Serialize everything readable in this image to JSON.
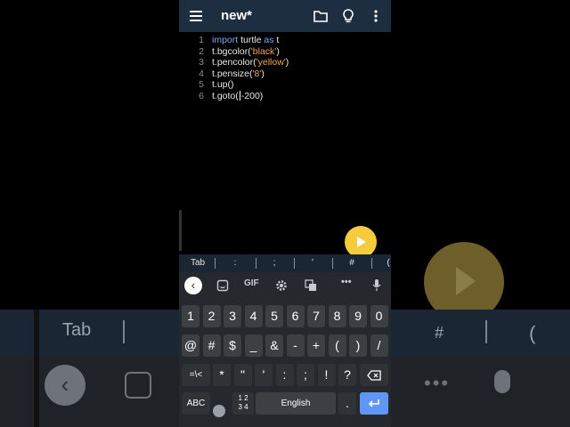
{
  "app": {
    "title": "new*",
    "icons": [
      "menu-icon",
      "folder-icon",
      "lightbulb-icon",
      "more-vert-icon"
    ]
  },
  "editor": {
    "lines": [
      {
        "num": "1",
        "parts": [
          {
            "t": "import",
            "k": "kw"
          },
          {
            "t": " turtle ",
            "k": "plain"
          },
          {
            "t": "as",
            "k": "kw"
          },
          {
            "t": " t",
            "k": "plain"
          }
        ]
      },
      {
        "num": "2",
        "parts": [
          {
            "t": "t.bgcolor(",
            "k": "plain"
          },
          {
            "t": "'black'",
            "k": "str"
          },
          {
            "t": ")",
            "k": "plain"
          }
        ]
      },
      {
        "num": "3",
        "parts": [
          {
            "t": "t.pencolor(",
            "k": "plain"
          },
          {
            "t": "'yellow'",
            "k": "str"
          },
          {
            "t": ")",
            "k": "plain"
          }
        ]
      },
      {
        "num": "4",
        "parts": [
          {
            "t": "t.pensize(",
            "k": "plain"
          },
          {
            "t": "'8'",
            "k": "str"
          },
          {
            "t": ")",
            "k": "plain"
          }
        ]
      },
      {
        "num": "5",
        "parts": [
          {
            "t": "t.up()",
            "k": "plain"
          }
        ]
      },
      {
        "num": "6",
        "parts": [
          {
            "t": "t.goto(",
            "k": "plain"
          },
          {
            "t": "|",
            "k": "cursor"
          },
          {
            "t": "-200)",
            "k": "plain"
          }
        ]
      }
    ]
  },
  "symbol_bar": [
    "Tab",
    ":",
    ";",
    "'",
    "#",
    "("
  ],
  "keyboard": {
    "toolbar": {
      "gif": "GIF"
    },
    "row1": [
      "1",
      "2",
      "3",
      "4",
      "5",
      "6",
      "7",
      "8",
      "9",
      "0"
    ],
    "row2": [
      "@",
      "#",
      "$",
      "_",
      "&",
      "-",
      "+",
      "(",
      ")",
      "/"
    ],
    "row3": [
      "=\\<",
      "*",
      "\"",
      "'",
      ":",
      ";",
      "!",
      "?"
    ],
    "row4": {
      "abc": "ABC",
      "num": "1 2\n3 4",
      "space": "English",
      "period": "."
    }
  },
  "colors": {
    "appbar": "#1c2e40",
    "keyword": "#7aa7ff",
    "string": "#f2a654",
    "fab": "#f6cc3c",
    "enter": "#5e97f6"
  }
}
